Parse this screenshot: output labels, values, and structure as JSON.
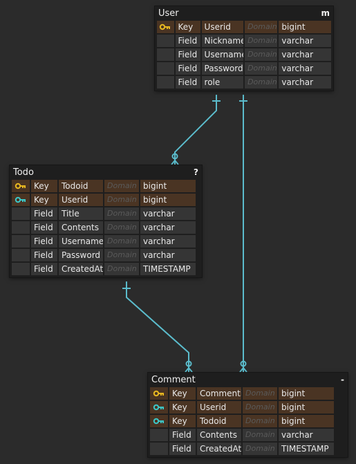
{
  "colors": {
    "background": "#2b2b2b",
    "table_bg": "#1e1e1e",
    "key_row": "#4a3423",
    "field_row": "#353535",
    "primary_key_icon": "#e8b820",
    "foreign_key_icon": "#3cc8c8",
    "relation_line": "#5bbccc"
  },
  "tables": {
    "user": {
      "name": "User",
      "note": "m",
      "rows": [
        {
          "icon": "primary-key-icon",
          "type": "Key",
          "name": "Userid",
          "domain": "Domain",
          "datatype": "bigint"
        },
        {
          "icon": "",
          "type": "Field",
          "name": "Nickname",
          "domain": "Domain",
          "datatype": "varchar"
        },
        {
          "icon": "",
          "type": "Field",
          "name": "Username",
          "domain": "Domain",
          "datatype": "varchar"
        },
        {
          "icon": "",
          "type": "Field",
          "name": "Password",
          "domain": "Domain",
          "datatype": "varchar"
        },
        {
          "icon": "",
          "type": "Field",
          "name": "role",
          "domain": "Domain",
          "datatype": "varchar"
        }
      ]
    },
    "todo": {
      "name": "Todo",
      "note": "?",
      "rows": [
        {
          "icon": "primary-key-icon",
          "type": "Key",
          "name": "Todoid",
          "domain": "Domain",
          "datatype": "bigint"
        },
        {
          "icon": "foreign-key-icon",
          "type": "Key",
          "name": "Userid",
          "domain": "Domain",
          "datatype": "bigint"
        },
        {
          "icon": "",
          "type": "Field",
          "name": "Title",
          "domain": "Domain",
          "datatype": "varchar"
        },
        {
          "icon": "",
          "type": "Field",
          "name": "Contents",
          "domain": "Domain",
          "datatype": "varchar"
        },
        {
          "icon": "",
          "type": "Field",
          "name": "Username",
          "domain": "Domain",
          "datatype": "varchar"
        },
        {
          "icon": "",
          "type": "Field",
          "name": "Password",
          "domain": "Domain",
          "datatype": "varchar"
        },
        {
          "icon": "",
          "type": "Field",
          "name": "CreatedAt",
          "domain": "Domain",
          "datatype": "TIMESTAMP"
        }
      ]
    },
    "comment": {
      "name": "Comment",
      "note": "-",
      "rows": [
        {
          "icon": "primary-key-icon",
          "type": "Key",
          "name": "Commentid",
          "domain": "Domain",
          "datatype": "bigint"
        },
        {
          "icon": "foreign-key-icon",
          "type": "Key",
          "name": "Userid",
          "domain": "Domain",
          "datatype": "bigint"
        },
        {
          "icon": "foreign-key-icon",
          "type": "Key",
          "name": "Todoid",
          "domain": "Domain",
          "datatype": "bigint"
        },
        {
          "icon": "",
          "type": "Field",
          "name": "Contents",
          "domain": "Domain",
          "datatype": "varchar"
        },
        {
          "icon": "",
          "type": "Field",
          "name": "CreatedAt",
          "domain": "Domain",
          "datatype": "TIMESTAMP"
        }
      ]
    }
  },
  "relations": [
    {
      "from": "user",
      "to": "todo",
      "from_cardinality": "one",
      "to_cardinality": "zero-or-many"
    },
    {
      "from": "user",
      "to": "comment",
      "from_cardinality": "one",
      "to_cardinality": "zero-or-many"
    },
    {
      "from": "todo",
      "to": "comment",
      "from_cardinality": "one",
      "to_cardinality": "zero-or-many"
    }
  ]
}
